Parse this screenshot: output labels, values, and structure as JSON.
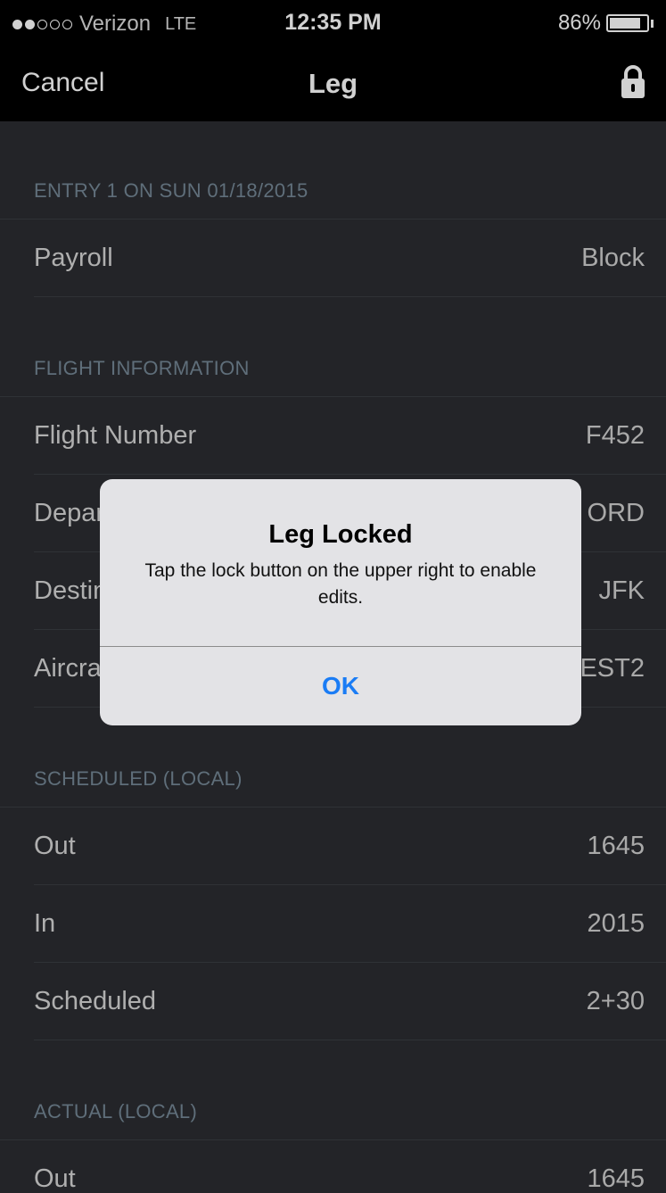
{
  "status_bar": {
    "carrier": "Verizon",
    "network": "LTE",
    "time": "12:35 PM",
    "battery_percent": "86%",
    "battery_level": 0.86,
    "signal_bars_filled": 2,
    "signal_bars_total": 5
  },
  "nav": {
    "cancel_label": "Cancel",
    "title": "Leg",
    "lock_icon": "lock-icon"
  },
  "sections": [
    {
      "header": "ENTRY 1 ON SUN 01/18/2015",
      "rows": [
        {
          "label": "Payroll",
          "value": "Block"
        }
      ]
    },
    {
      "header": "FLIGHT INFORMATION",
      "rows": [
        {
          "label": "Flight Number",
          "value": "F452"
        },
        {
          "label": "Departure",
          "value": "ORD"
        },
        {
          "label": "Destination",
          "value": "JFK"
        },
        {
          "label": "Aircraft",
          "value": "EST2"
        }
      ]
    },
    {
      "header": "SCHEDULED (LOCAL)",
      "rows": [
        {
          "label": "Out",
          "value": "1645"
        },
        {
          "label": "In",
          "value": "2015"
        },
        {
          "label": "Scheduled",
          "value": "2+30"
        }
      ]
    },
    {
      "header": "ACTUAL (LOCAL)",
      "rows": [
        {
          "label": "Out",
          "value": "1645"
        }
      ]
    }
  ],
  "alert": {
    "title": "Leg Locked",
    "message": "Tap the lock button on the upper right to enable edits.",
    "ok_label": "OK"
  },
  "colors": {
    "background": "#2b2d31",
    "bar": "#000000",
    "section_header": "#748795",
    "alert_bg": "#e3e3e6",
    "alert_button": "#1a7cf5"
  }
}
